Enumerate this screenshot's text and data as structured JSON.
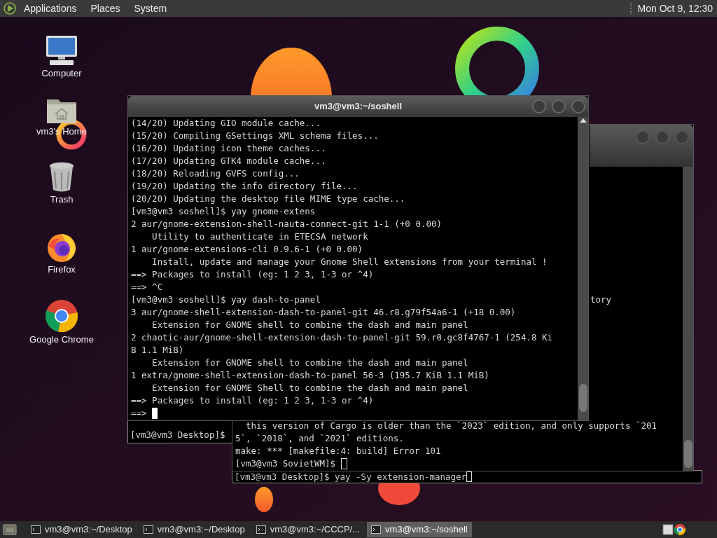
{
  "top_panel": {
    "menus": [
      "Applications",
      "Places",
      "System"
    ],
    "clock": "Mon Oct 9, 12:30"
  },
  "desktop_icons": [
    {
      "label": "Computer",
      "kind": "computer"
    },
    {
      "label": "vm3's Home",
      "kind": "home"
    },
    {
      "label": "Trash",
      "kind": "trash"
    },
    {
      "label": "Firefox",
      "kind": "firefox"
    },
    {
      "label": "Google Chrome",
      "kind": "chrome"
    }
  ],
  "terminal_back": {
    "lines": [
      "[vm3@vm3 Desktop]$"
    ]
  },
  "terminal_sovietwm": {
    "upper_lines": [
      "tory"
    ],
    "lines": [
      "  this version of Cargo is older than the `2023` edition, and only supports `201",
      "5`, `2018`, and `2021` editions.",
      "make: *** [makefile:4: build] Error 101",
      "[vm3@vm3 SovietWM]$ "
    ]
  },
  "terminal_desktop": {
    "line": "[vm3@vm3 Desktop]$ yay -Sy extension-manager"
  },
  "terminal_soshell": {
    "title": "vm3@vm3:~/soshell",
    "lines": [
      "(14/20) Updating GIO module cache...",
      "(15/20) Compiling GSettings XML schema files...",
      "(16/20) Updating icon theme caches...",
      "(17/20) Updating GTK4 module cache...",
      "(18/20) Reloading GVFS config...",
      "(19/20) Updating the info directory file...",
      "(20/20) Updating the desktop file MIME type cache...",
      "[vm3@vm3 soshell]$ yay gnome-extens",
      "2 aur/gnome-extension-shell-nauta-connect-git 1-1 (+0 0.00)",
      "    Utility to authenticate in ETECSA network",
      "1 aur/gnome-extensions-cli 0.9.6-1 (+0 0.00)",
      "    Install, update and manage your Gnome Shell extensions from your terminal !",
      "==> Packages to install (eg: 1 2 3, 1-3 or ^4)",
      "==> ^C",
      "[vm3@vm3 soshell]$ yay dash-to-panel",
      "3 aur/gnome-shell-extension-dash-to-panel-git 46.r8.g79f54a6-1 (+18 0.00)",
      "    Extension for GNOME shell to combine the dash and main panel",
      "2 chaotic-aur/gnome-shell-extension-dash-to-panel-git 59.r0.gc8f4767-1 (254.8 Ki",
      "B 1.1 MiB)",
      "    Extension for GNOME shell to combine the dash and main panel",
      "1 extra/gnome-shell-extension-dash-to-panel 56-3 (195.7 KiB 1.1 MiB)",
      "    Extension for GNOME Shell to combine the dash and main panel",
      "==> Packages to install (eg: 1 2 3, 1-3 or ^4)",
      "==> "
    ]
  },
  "taskbar": {
    "tasks": [
      {
        "label": "vm3@vm3:~/Desktop",
        "selected": false
      },
      {
        "label": "vm3@vm3:~/Desktop",
        "selected": false
      },
      {
        "label": "vm3@vm3:~/CCCP/...",
        "selected": false
      },
      {
        "label": "vm3@vm3:~/soshell",
        "selected": true
      }
    ]
  }
}
